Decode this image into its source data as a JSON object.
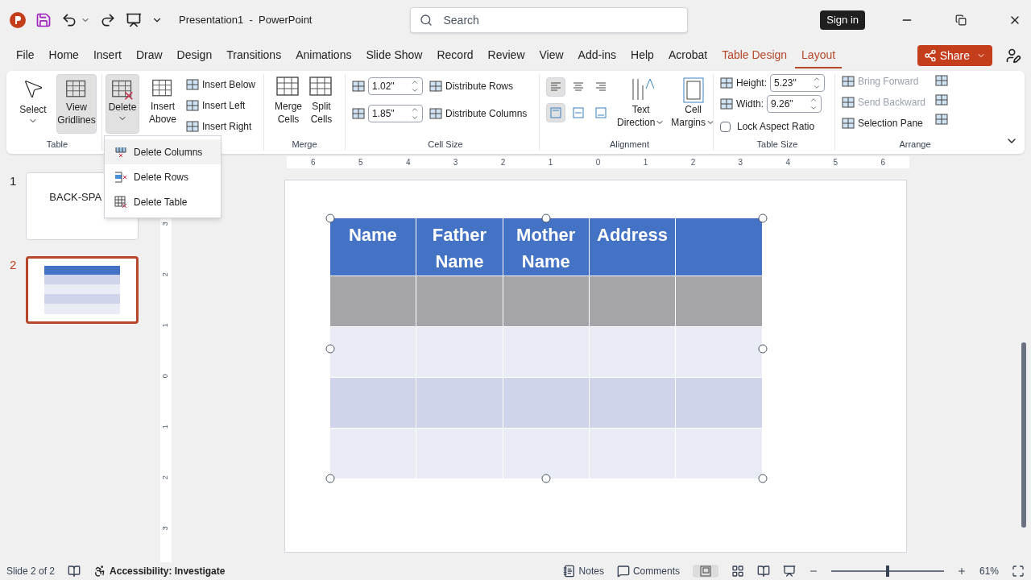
{
  "window": {
    "title": "Presentation1  -  PowerPoint",
    "search_placeholder": "Search",
    "sign_in": "Sign in"
  },
  "tabs": [
    {
      "label": "File",
      "selected": false,
      "contextual": false
    },
    {
      "label": "Home",
      "selected": false,
      "contextual": false
    },
    {
      "label": "Insert",
      "selected": false,
      "contextual": false
    },
    {
      "label": "Draw",
      "selected": false,
      "contextual": false
    },
    {
      "label": "Design",
      "selected": false,
      "contextual": false
    },
    {
      "label": "Transitions",
      "selected": false,
      "contextual": false
    },
    {
      "label": "Animations",
      "selected": false,
      "contextual": false
    },
    {
      "label": "Slide Show",
      "selected": false,
      "contextual": false
    },
    {
      "label": "Record",
      "selected": false,
      "contextual": false
    },
    {
      "label": "Review",
      "selected": false,
      "contextual": false
    },
    {
      "label": "View",
      "selected": false,
      "contextual": false
    },
    {
      "label": "Add-ins",
      "selected": false,
      "contextual": false
    },
    {
      "label": "Help",
      "selected": false,
      "contextual": false
    },
    {
      "label": "Acrobat",
      "selected": false,
      "contextual": false
    },
    {
      "label": "Table Design",
      "selected": false,
      "contextual": true
    },
    {
      "label": "Layout",
      "selected": true,
      "contextual": true
    }
  ],
  "share": "Share",
  "ribbon": {
    "table_group": {
      "label": "Table",
      "select": "Select",
      "view_gridlines": {
        "label": "View Gridlines",
        "selected": true
      }
    },
    "rows_columns": {
      "delete": {
        "label": "Delete",
        "expanded": true
      },
      "insert_above": "Insert Above",
      "insert_below": "Insert Below",
      "insert_left": "Insert Left",
      "insert_right": "Insert Right"
    },
    "merge": {
      "label": "Merge",
      "merge_cells": "Merge Cells",
      "split_cells": "Split Cells"
    },
    "cell_size": {
      "label": "Cell Size",
      "height": "1.02\"",
      "width": "1.85\"",
      "distribute_rows": "Distribute Rows",
      "distribute_columns": "Distribute Columns"
    },
    "alignment": {
      "label": "Alignment",
      "text_direction": "Text Direction",
      "cell_margins": "Cell Margins",
      "horizontal": [
        {
          "selected": true
        },
        {
          "selected": false
        },
        {
          "selected": false
        }
      ],
      "vertical": [
        {
          "selected": true
        },
        {
          "selected": false
        },
        {
          "selected": false
        }
      ]
    },
    "table_size": {
      "label": "Table Size",
      "height_label": "Height:",
      "height": "5.23\"",
      "width_label": "Width:",
      "width": "9.26\"",
      "lock_aspect": {
        "label": "Lock Aspect Ratio",
        "checked": false
      }
    },
    "arrange": {
      "label": "Arrange",
      "bring_forward": {
        "label": "Bring Forward",
        "disabled": true
      },
      "send_backward": {
        "label": "Send Backward",
        "disabled": true
      },
      "selection_pane": {
        "label": "Selection Pane",
        "disabled": false
      }
    }
  },
  "delete_menu": [
    {
      "label": "Delete Columns",
      "kind": "columns",
      "selected": true
    },
    {
      "label": "Delete Rows",
      "kind": "rows",
      "selected": false
    },
    {
      "label": "Delete Table",
      "kind": "table",
      "selected": false
    }
  ],
  "thumbnails": [
    {
      "number": "1",
      "selected": false,
      "kind": "title",
      "title": "BACK-SPA"
    },
    {
      "number": "2",
      "selected": true,
      "kind": "table"
    }
  ],
  "ruler": {
    "horizontal": [
      "6",
      "5",
      "4",
      "3",
      "2",
      "1",
      "0",
      "1",
      "2",
      "3",
      "4",
      "5",
      "6"
    ],
    "vertical": [
      "3",
      "2",
      "1",
      "0",
      "1",
      "2",
      "3"
    ]
  },
  "table": {
    "columns": [
      "Name",
      "Father Name",
      "Mother Name",
      "Address",
      ""
    ],
    "rows": [
      {
        "selected": true
      },
      {
        "selected": false
      },
      {
        "selected": false
      },
      {
        "selected": false
      }
    ]
  },
  "status_bar": {
    "slide": "Slide 2 of 2",
    "accessibility": "Accessibility: Investigate",
    "notes": "Notes",
    "comments": "Comments",
    "zoom": "61%",
    "zoom_slider": {
      "level": 0.5
    }
  }
}
